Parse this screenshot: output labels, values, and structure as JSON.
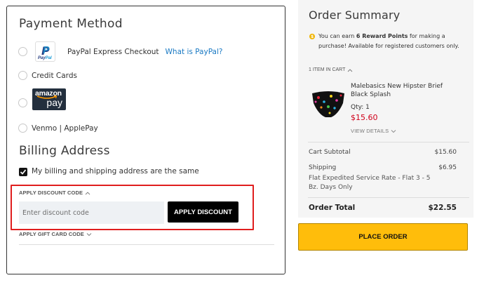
{
  "payment": {
    "title": "Payment Method",
    "paypal": {
      "label": "PayPal Express Checkout",
      "link": "What is PayPal?",
      "logo_text_a": "Pay",
      "logo_text_b": "Pal"
    },
    "credit_cards": {
      "label": "Credit Cards"
    },
    "amazon": {
      "logo_top": "amazon",
      "logo_bottom": "pay"
    },
    "venmo": {
      "label": "Venmo | ApplePay"
    }
  },
  "billing": {
    "title": "Billing Address",
    "same_address_label": "My billing and shipping address are the same",
    "same_address_checked": true
  },
  "discount": {
    "title": "APPLY DISCOUNT CODE",
    "placeholder": "Enter discount code",
    "value": "",
    "button": "APPLY DISCOUNT",
    "expanded": true
  },
  "gift_card": {
    "title": "APPLY GIFT CARD CODE",
    "expanded": false
  },
  "summary": {
    "title": "Order Summary",
    "reward_prefix": "You can earn ",
    "reward_points": "6 Reward Points",
    "reward_suffix": " for making a purchase! Available for registered customers only.",
    "items_toggle": "1 ITEM IN CART",
    "product": {
      "name": "Malebasics New Hipster Brief Black Splash",
      "qty": "Qty: 1",
      "price": "$15.60",
      "view_details": "VIEW DETAILS"
    },
    "subtotal_label": "Cart Subtotal",
    "subtotal_value": "$15.60",
    "shipping_label": "Shipping",
    "shipping_value": "$6.95",
    "shipping_method": "Flat Expedited Service Rate - Flat 3 - 5 Bz. Days Only",
    "total_label": "Order Total",
    "total_value": "$22.55"
  },
  "place_order": "PLACE ORDER",
  "colors": {
    "accent_link": "#1979c3",
    "price_red": "#d0001a",
    "place_order_bg": "#ffbd0b",
    "highlight": "#e01e1e"
  }
}
